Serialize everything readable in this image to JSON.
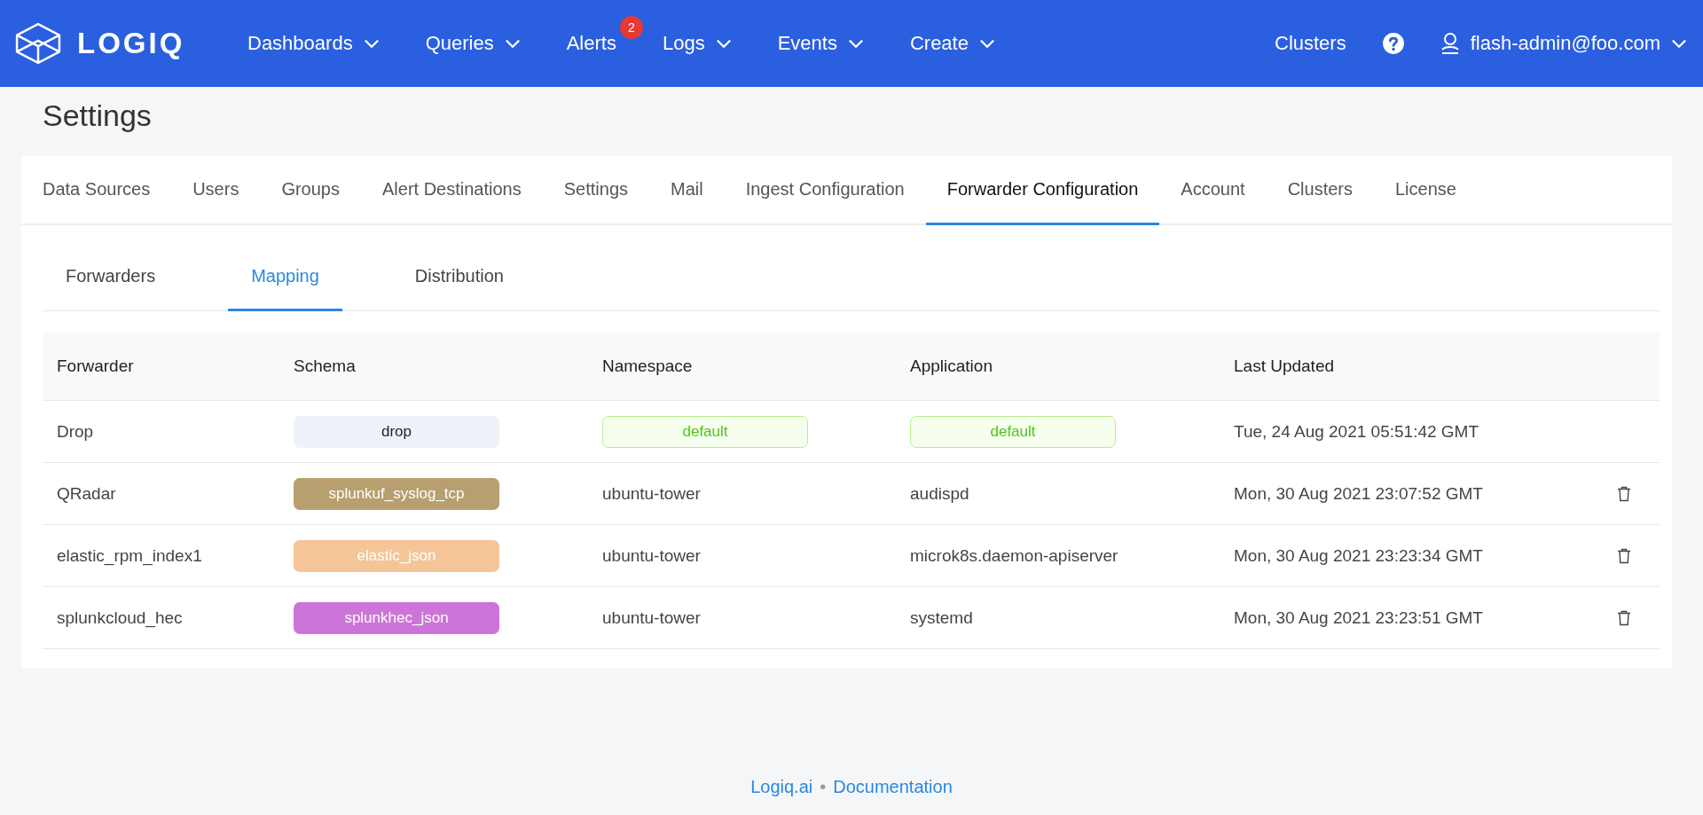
{
  "navbar": {
    "logo": "LOGIQ",
    "menu": [
      {
        "label": "Dashboards",
        "dropdown": true
      },
      {
        "label": "Queries",
        "dropdown": true
      },
      {
        "label": "Alerts",
        "dropdown": false,
        "badge": "2"
      },
      {
        "label": "Logs",
        "dropdown": true
      },
      {
        "label": "Events",
        "dropdown": true
      },
      {
        "label": "Create",
        "dropdown": true
      }
    ],
    "clusters": "Clusters",
    "user": "flash-admin@foo.com"
  },
  "page_title": "Settings",
  "tabs": [
    {
      "label": "Data Sources",
      "selected": false
    },
    {
      "label": "Users",
      "selected": false
    },
    {
      "label": "Groups",
      "selected": false
    },
    {
      "label": "Alert Destinations",
      "selected": false
    },
    {
      "label": "Settings",
      "selected": false
    },
    {
      "label": "Mail",
      "selected": false
    },
    {
      "label": "Ingest Configuration",
      "selected": false
    },
    {
      "label": "Forwarder Configuration",
      "selected": true
    },
    {
      "label": "Account",
      "selected": false
    },
    {
      "label": "Clusters",
      "selected": false
    },
    {
      "label": "License",
      "selected": false
    }
  ],
  "subtabs": [
    {
      "label": "Forwarders",
      "selected": false
    },
    {
      "label": "Mapping",
      "selected": true
    },
    {
      "label": "Distribution",
      "selected": false
    }
  ],
  "table": {
    "columns": [
      "Forwarder",
      "Schema",
      "Namespace",
      "Application",
      "Last Updated"
    ],
    "rows": [
      {
        "forwarder": "Drop",
        "schema": {
          "text": "drop",
          "color": "#eef2f8"
        },
        "namespace": {
          "kind": "tag",
          "text": "default"
        },
        "application": {
          "kind": "tag",
          "text": "default"
        },
        "last_updated": "Tue, 24 Aug 2021 05:51:42 GMT",
        "deletable": false
      },
      {
        "forwarder": "QRadar",
        "schema": {
          "text": "splunkuf_syslog_tcp",
          "color": "#b89f70"
        },
        "namespace": {
          "kind": "text",
          "text": "ubuntu-tower"
        },
        "application": {
          "kind": "text",
          "text": "audispd"
        },
        "last_updated": "Mon, 30 Aug 2021 23:07:52 GMT",
        "deletable": true
      },
      {
        "forwarder": "elastic_rpm_index1",
        "schema": {
          "text": "elastic_json",
          "color": "#f5c597"
        },
        "namespace": {
          "kind": "text",
          "text": "ubuntu-tower"
        },
        "application": {
          "kind": "text",
          "text": "microk8s.daemon-apiserver"
        },
        "last_updated": "Mon, 30 Aug 2021 23:23:34 GMT",
        "deletable": true
      },
      {
        "forwarder": "splunkcloud_hec",
        "schema": {
          "text": "splunkhec_json",
          "color": "#cd74d8"
        },
        "namespace": {
          "kind": "text",
          "text": "ubuntu-tower"
        },
        "application": {
          "kind": "text",
          "text": "systemd"
        },
        "last_updated": "Mon, 30 Aug 2021 23:23:51 GMT",
        "deletable": true
      }
    ]
  },
  "footer": {
    "links": [
      "Logiq.ai",
      "Documentation"
    ],
    "separator": "•"
  }
}
